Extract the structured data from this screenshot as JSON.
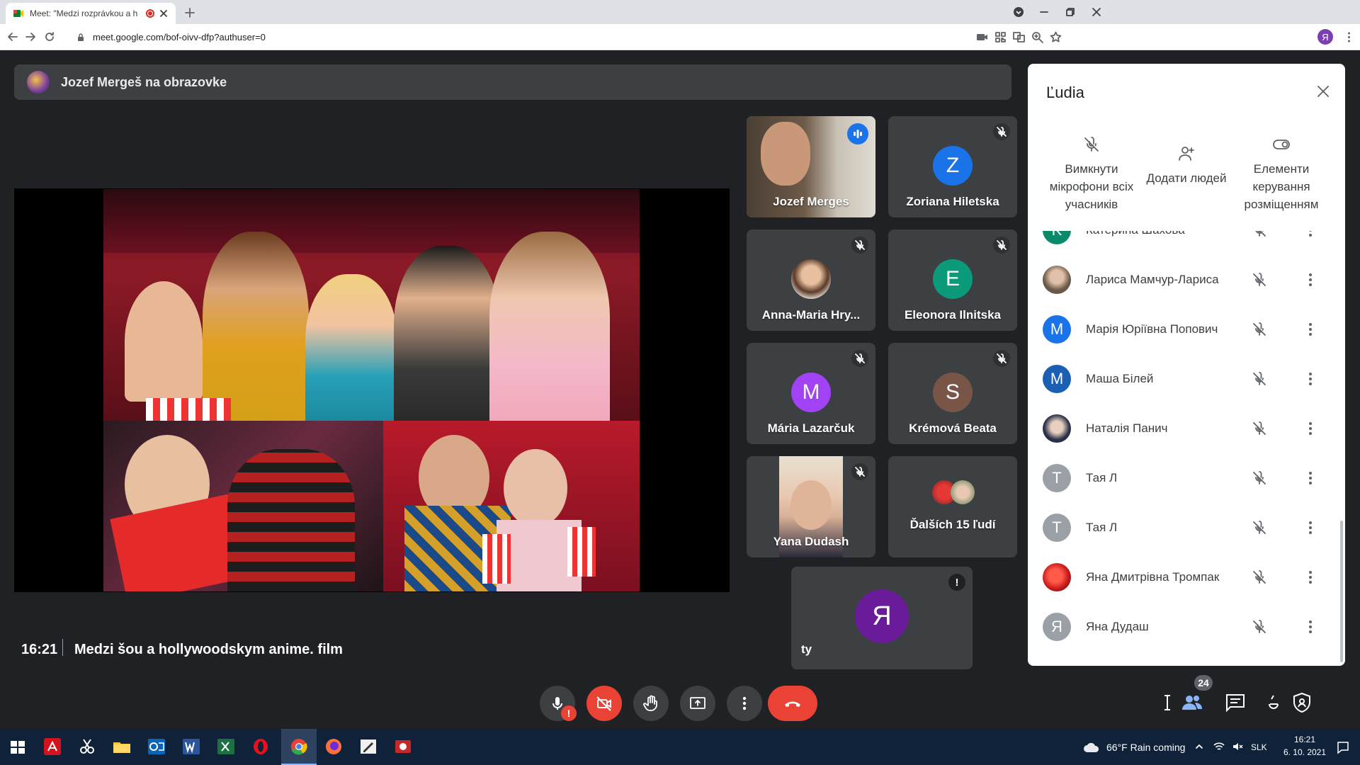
{
  "browser": {
    "tab_title": "Meet: \"Medzi rozprávkou a h",
    "url": "meet.google.com/bof-oivv-dfp?authuser=0",
    "profile_initial": "Я"
  },
  "meet": {
    "presenter_banner": "Jozef Mergeš na obrazovke",
    "tiles": [
      {
        "name": "Jozef Merges",
        "type": "video",
        "speaking": true
      },
      {
        "name": "Zoriana Hiletska",
        "initial": "Z",
        "color": "#1a73e8",
        "muted": true
      },
      {
        "name": "Anna-Maria Hry...",
        "type": "photo",
        "muted": true
      },
      {
        "name": "Eleonora Ilnitska",
        "initial": "E",
        "color": "#0b9a7a",
        "muted": true
      },
      {
        "name": "Mária Lazarčuk",
        "initial": "M",
        "color": "#a142f4",
        "muted": true
      },
      {
        "name": "Krémová Beata",
        "initial": "S",
        "color": "#795548",
        "muted": true
      },
      {
        "name": "Yana Dudash",
        "type": "video",
        "muted": true
      },
      {
        "name": "Ďalších 15 ľudí",
        "type": "group"
      }
    ],
    "self_tile": {
      "name": "ty",
      "initial": "Я",
      "color": "#6a1b9a"
    },
    "clock": "16:21",
    "meeting_title": "Medzi šou a hollywoodskym anime. film",
    "participants_count": "24"
  },
  "people_panel": {
    "title": "Ľudia",
    "actions": [
      {
        "label": "Вимкнути мікрофони всіх учасників",
        "icon": "mic-off-icon"
      },
      {
        "label": "Додати людей",
        "icon": "add-person-icon"
      },
      {
        "label": "Елементи керування розміщенням",
        "icon": "toggle-icon"
      }
    ],
    "people": [
      {
        "name": "Катерина Шахова",
        "initial": "K",
        "color": "#0b8a6b"
      },
      {
        "name": "Лариса Мамчур-Лариса",
        "initial": "",
        "color": "#8d7a6a",
        "photo": true
      },
      {
        "name": "Марія Юріївна Попович",
        "initial": "M",
        "color": "#1a73e8"
      },
      {
        "name": "Маша Білей",
        "initial": "M",
        "color": "#1a5fb4"
      },
      {
        "name": "Наталія Панич",
        "initial": "",
        "color": "#4a4f6a",
        "photo": true
      },
      {
        "name": "Тая Л",
        "initial": "T",
        "color": "#9aa0a6"
      },
      {
        "name": "Тая Л",
        "initial": "T",
        "color": "#9aa0a6"
      },
      {
        "name": "Яна Дмитрівна Тромпак",
        "initial": "",
        "color": "#d93025",
        "photo": true
      },
      {
        "name": "Яна Дудаш",
        "initial": "Я",
        "color": "#9aa0a6"
      }
    ]
  },
  "taskbar": {
    "weather": "66°F  Rain coming",
    "lang": "SLK",
    "time": "16:21",
    "date": "6. 10. 2021"
  }
}
